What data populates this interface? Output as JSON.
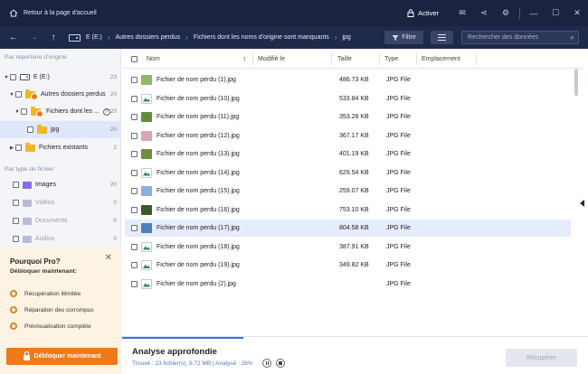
{
  "titlebar": {
    "home_text": "Retour à la page d'accueil",
    "activate_label": "Activer"
  },
  "nav": {
    "breadcrumbs": [
      "E (E:)",
      "Autres dossiers perdus",
      "Fichiers dont les noms d'origine sont manquants",
      "jpg"
    ],
    "filter_label": "Filtre",
    "search_placeholder": "Rechercher des données"
  },
  "sidebar": {
    "by_dir_title": "Par répertoire d'origine",
    "tree": [
      {
        "label": "E (E:)",
        "count": "23"
      },
      {
        "label": "Autres dossiers perdus",
        "count": "20"
      },
      {
        "label": "Fichiers dont les ...",
        "count": "20"
      },
      {
        "label": "jpg",
        "count": "20"
      },
      {
        "label": "Fichiers existants",
        "count": "2"
      }
    ],
    "by_type_title": "Par type de fichier",
    "types": [
      {
        "label": "Images",
        "count": "20",
        "color": "#8b6cf0"
      },
      {
        "label": "Vidéos",
        "count": "0",
        "color": "#9aa3c4"
      },
      {
        "label": "Documents",
        "count": "0",
        "color": "#9aa3c4"
      },
      {
        "label": "Audios",
        "count": "0",
        "color": "#9aa3c4"
      }
    ]
  },
  "pro": {
    "title": "Pourquoi Pro?",
    "subtitle": "Débloquer maintenant:",
    "features": [
      "Récupération illimitée",
      "Réparation des corrompus",
      "Prévisualisation complète"
    ],
    "unlock_label": "Débloquer maintenant"
  },
  "table": {
    "headers": {
      "name": "Nom",
      "modified": "Modifié le",
      "size": "Taille",
      "type": "Type",
      "location": "Emplacement"
    },
    "rows": [
      {
        "name": "Fichier de nom perdu (1).jpg",
        "size": "486.73 KB",
        "type": "JPG File",
        "thumb": "#8fb86a"
      },
      {
        "name": "Fichier de nom perdu (10).jpg",
        "size": "533.84 KB",
        "type": "JPG File",
        "thumb": "doc"
      },
      {
        "name": "Fichier de nom perdu (11).jpg",
        "size": "353.28 KB",
        "type": "JPG File",
        "thumb": "#5f8f3a"
      },
      {
        "name": "Fichier de nom perdu (12).jpg",
        "size": "367.17 KB",
        "type": "JPG File",
        "thumb": "#d9a6b8"
      },
      {
        "name": "Fichier de nom perdu (13).jpg",
        "size": "401.19 KB",
        "type": "JPG File",
        "thumb": "#6b8f3f"
      },
      {
        "name": "Fichier de nom perdu (14).jpg",
        "size": "629.54 KB",
        "type": "JPG File",
        "thumb": "doc"
      },
      {
        "name": "Fichier de nom perdu (15).jpg",
        "size": "259.07 KB",
        "type": "JPG File",
        "thumb": "#8aaee0"
      },
      {
        "name": "Fichier de nom perdu (16).jpg",
        "size": "753.10 KB",
        "type": "JPG File",
        "thumb": "#3d5a2a"
      },
      {
        "name": "Fichier de nom perdu (17).jpg",
        "size": "804.58 KB",
        "type": "JPG File",
        "thumb": "#4f7fb8"
      },
      {
        "name": "Fichier de nom perdu (18).jpg",
        "size": "387.91 KB",
        "type": "JPG File",
        "thumb": "doc"
      },
      {
        "name": "Fichier de nom perdu (19).jpg",
        "size": "349.82 KB",
        "type": "JPG File",
        "thumb": "doc"
      },
      {
        "name": "Fichier de nom perdu (2).jpg",
        "size": "",
        "type": "JPG File",
        "thumb": "doc"
      }
    ],
    "selected_index": 8
  },
  "scan": {
    "title": "Analyse approfondie",
    "info": "Trouvé : 23 fichier(s), 9.72 MB | Analysé : 26%",
    "progress": 0.26,
    "recover_label": "Récupérer"
  }
}
